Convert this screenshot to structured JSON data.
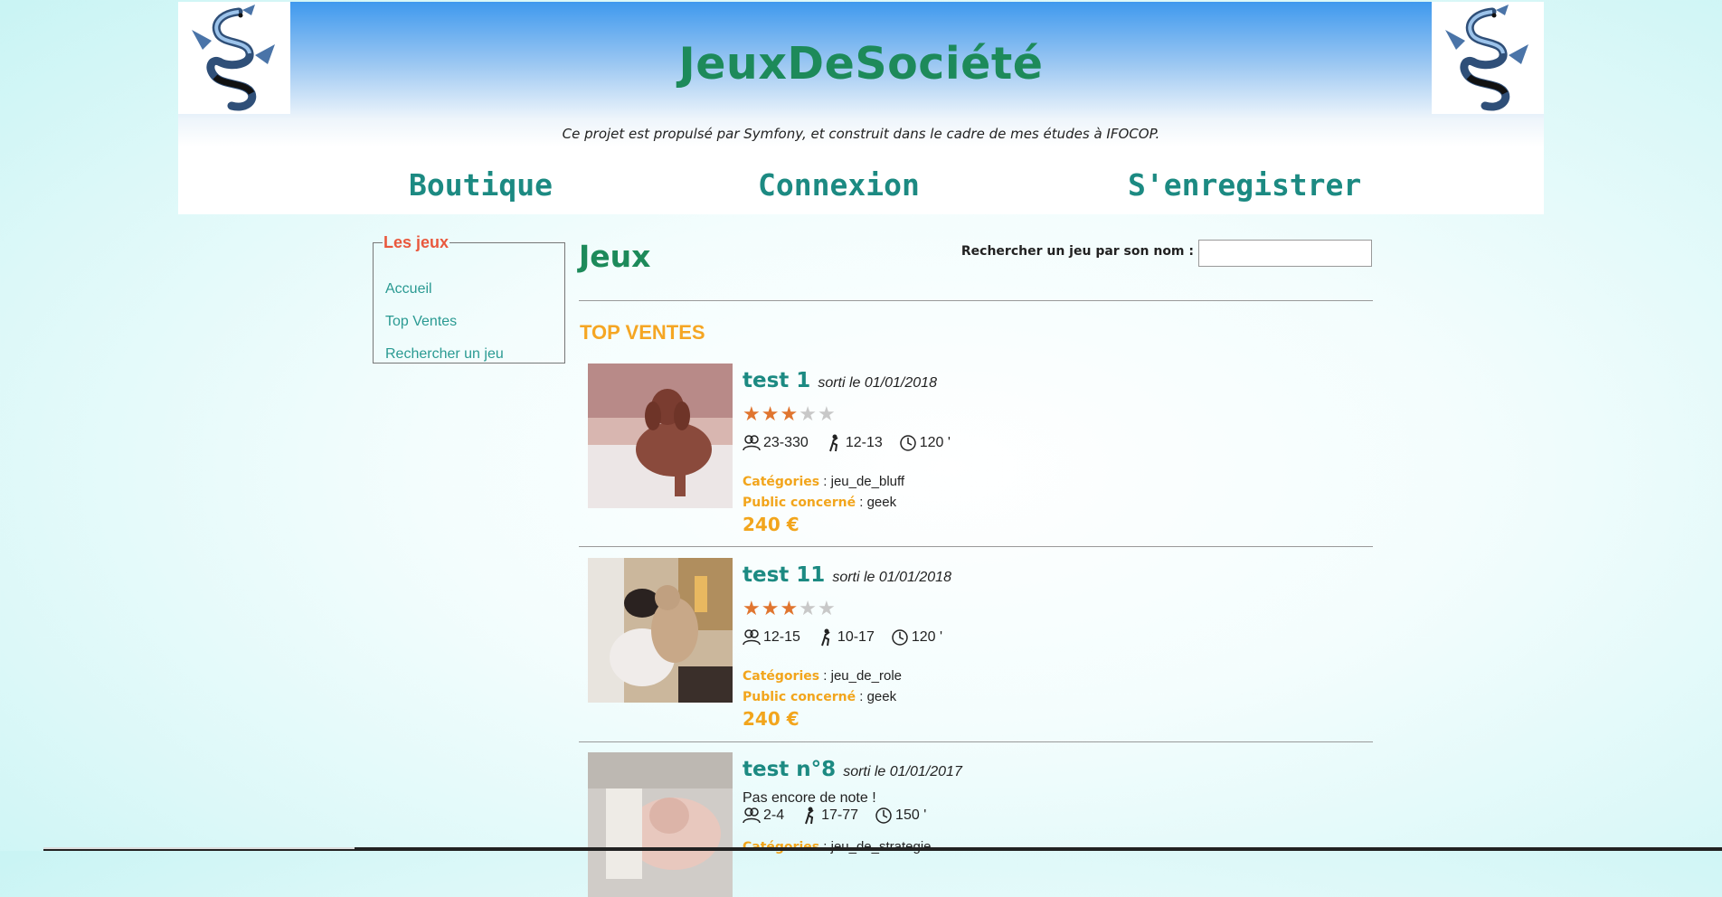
{
  "header": {
    "title": "JeuxDeSociété",
    "tagline": "Ce projet est propulsé par Symfony, et construit dans le cadre de mes études à IFOCOP.",
    "logo_icon": "dragon-logo-icon"
  },
  "nav": {
    "items": [
      {
        "label": "Boutique"
      },
      {
        "label": "Connexion"
      },
      {
        "label": "S'enregistrer"
      }
    ]
  },
  "sidebar": {
    "legend": "Les jeux",
    "items": [
      {
        "label": "Accueil"
      },
      {
        "label": "Top Ventes"
      },
      {
        "label": "Rechercher un jeu"
      }
    ]
  },
  "main": {
    "title": "Jeux",
    "search_label": "Rechercher un jeu par son nom :",
    "search_value": "",
    "section_title": "TOP VENTES"
  },
  "labels": {
    "categories": "Catégories",
    "public": "Public concerné"
  },
  "games": [
    {
      "name": "test 1",
      "released": "sorti le 01/01/2018",
      "rating": 3,
      "rating_max": 5,
      "players": "23-330",
      "ages": "12-13",
      "duration": "120 '",
      "categories": "jeu_de_bluff",
      "public": "geek",
      "price": "240 €"
    },
    {
      "name": "test 11",
      "released": "sorti le 01/01/2018",
      "rating": 3,
      "rating_max": 5,
      "players": "12-15",
      "ages": "10-17",
      "duration": "120 '",
      "categories": "jeu_de_role",
      "public": "geek",
      "price": "240 €"
    },
    {
      "name": "test n°8",
      "released": "sorti le 01/01/2017",
      "no_rating_text": "Pas encore de note !",
      "players": "2-4",
      "ages": "17-77",
      "duration": "150 '",
      "categories": "jeu_de_strategie"
    }
  ],
  "colors": {
    "title_green": "#1d8a5a",
    "nav_teal": "#1c8a82",
    "accent_orange": "#f5a623",
    "star_orange": "#e0752f",
    "sidebar_legend": "#e9583d"
  }
}
